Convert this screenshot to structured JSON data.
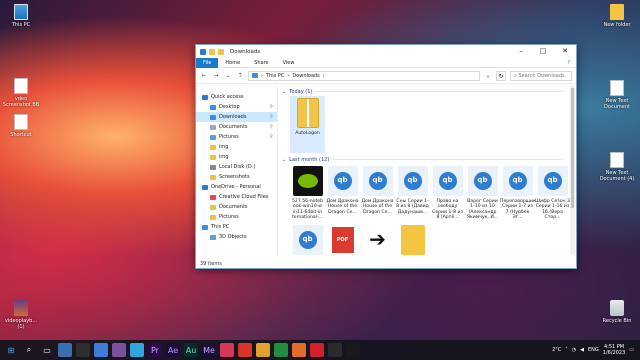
{
  "desktop": {
    "icons": [
      {
        "label": "This PC",
        "kind": "pc"
      },
      {
        "label": "New folder",
        "kind": "folder"
      },
      {
        "label": "New Text Document (4)",
        "kind": "doc"
      },
      {
        "label": "vdeo Screenshot BB",
        "kind": "doc"
      },
      {
        "label": "New Text Document",
        "kind": "doc"
      },
      {
        "label": "Shortcut",
        "kind": "doc"
      },
      {
        "label": "New Text Document (4)",
        "kind": "doc"
      },
      {
        "label": "videoplayb... (1)",
        "kind": "img"
      },
      {
        "label": "Recycle Bin",
        "kind": "bin"
      }
    ]
  },
  "explorer": {
    "title": "Downloads",
    "ribbon_tabs": [
      "File",
      "Home",
      "Share",
      "View"
    ],
    "path": [
      "This PC",
      "Downloads"
    ],
    "search_placeholder": "Search Downloads",
    "sidebar": [
      {
        "label": "Quick access",
        "lvl": 0,
        "color": "#2b79d0",
        "sel": false,
        "pin": false
      },
      {
        "label": "Desktop",
        "lvl": 1,
        "color": "#3a8ee6",
        "sel": false,
        "pin": true
      },
      {
        "label": "Downloads",
        "lvl": 1,
        "color": "#3a8ee6",
        "sel": true,
        "pin": true
      },
      {
        "label": "Documents",
        "lvl": 1,
        "color": "#9aa6b2",
        "sel": false,
        "pin": true
      },
      {
        "label": "Pictures",
        "lvl": 1,
        "color": "#5aa0d8",
        "sel": false,
        "pin": true
      },
      {
        "label": "img",
        "lvl": 1,
        "color": "#f0c040",
        "sel": false,
        "pin": false
      },
      {
        "label": "img",
        "lvl": 1,
        "color": "#f0c040",
        "sel": false,
        "pin": false
      },
      {
        "label": "Local Disk (D:)",
        "lvl": 1,
        "color": "#888888",
        "sel": false,
        "pin": false
      },
      {
        "label": "Screenshots",
        "lvl": 1,
        "color": "#f0c040",
        "sel": false,
        "pin": false
      },
      {
        "label": "OneDrive - Personal",
        "lvl": 0,
        "color": "#2b79d0",
        "sel": false,
        "pin": false
      },
      {
        "label": "Creative Cloud Files",
        "lvl": 1,
        "color": "#e34850",
        "sel": false,
        "pin": false
      },
      {
        "label": "Documents",
        "lvl": 1,
        "color": "#f0c040",
        "sel": false,
        "pin": false
      },
      {
        "label": "Pictures",
        "lvl": 1,
        "color": "#f0c040",
        "sel": false,
        "pin": false
      },
      {
        "label": "This PC",
        "lvl": 0,
        "color": "#3a8ee6",
        "sel": false,
        "pin": false
      },
      {
        "label": "3D Objects",
        "lvl": 1,
        "color": "#5aa0d8",
        "sel": false,
        "pin": false
      }
    ],
    "groups": [
      {
        "title": "Today (1)",
        "items": [
          {
            "label": "AutoLogon",
            "kind": "zip",
            "sel": true
          }
        ]
      },
      {
        "title": "Last month (12)",
        "items": [
          {
            "label": "527.56-noteb ook-win10-w in11-64bit-in ternational-...",
            "kind": "nv"
          },
          {
            "label": "Дом Дракона House of the Dragon Ce...",
            "kind": "qb"
          },
          {
            "label": "Дом Дракона House of the Dragon Ce...",
            "kind": "qb"
          },
          {
            "label": "Сны Серии 1-8 из 8 (Давид Дадунашв...",
            "kind": "qb"
          },
          {
            "label": "Право на свободу Серии 1-8 из 8 (Артё...",
            "kind": "qb"
          },
          {
            "label": "Варег Серии 1-10 из 10 (Александр Якимчук, И...",
            "kind": "qb"
          },
          {
            "label": "Переговорщик Серии 1-7 из 7 (Нурбек Эг...",
            "kind": "qb"
          },
          {
            "label": "Шифр Сезон 3 Серии 1-16 из 16 (Вера Стор...",
            "kind": "qb"
          },
          {
            "label": "Надзое Серии 1-9 из 9",
            "kind": "qb"
          },
          {
            "label": "40997935",
            "kind": "pdf"
          },
          {
            "label": "free-icon-arr ow-right-413 пенд",
            "kind": "arrow"
          },
          {
            "label": "temp",
            "kind": "fold"
          }
        ]
      }
    ],
    "status": "39 items"
  },
  "taskbar": {
    "weather": "2°C",
    "time": "4:51 PM",
    "date": "1/6/2023",
    "lang": "ENG"
  }
}
